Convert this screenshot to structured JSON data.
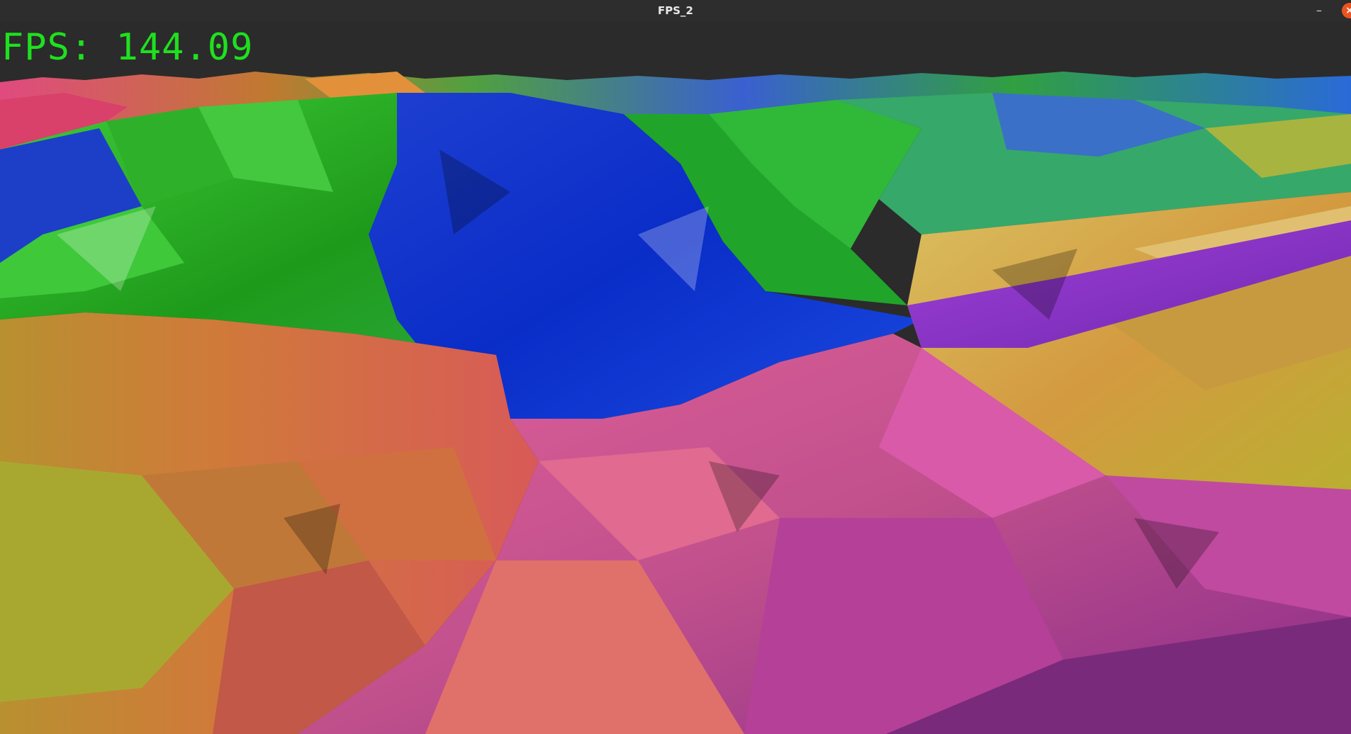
{
  "window": {
    "title": "FPS_2",
    "minimize_glyph": "–",
    "close_glyph": "×"
  },
  "overlay": {
    "fps_label": "FPS:",
    "fps_value": "144.09"
  },
  "scene": {
    "description_icon": "terrain-render"
  },
  "colors": {
    "titlebar": "#2d2d2d",
    "background": "#2b2b2b",
    "fps_text": "#1fe01f",
    "close_button": "#e95420"
  }
}
